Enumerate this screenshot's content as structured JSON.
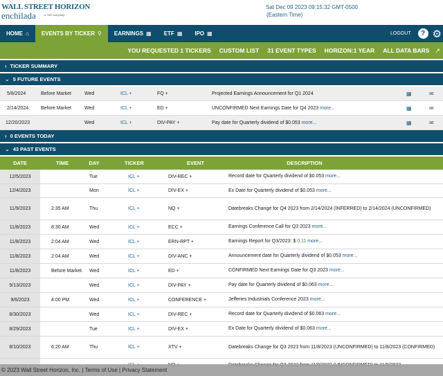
{
  "logo": {
    "line1": "WALL STREET HORIZON",
    "line2": "enchilada",
    "sub": "a TMX company"
  },
  "datetime": {
    "line1": "Sat Dec 09 2023 09:15:32 GMT-0500",
    "line2": "(Eastern Time)"
  },
  "nav": {
    "items": [
      {
        "label": "HOME",
        "icon": "home-icon"
      },
      {
        "label": "EVENTS BY TICKER",
        "icon": "search-icon"
      },
      {
        "label": "EARNINGS",
        "icon": "calendar-icon"
      },
      {
        "label": "ETF",
        "icon": "calendar-icon"
      },
      {
        "label": "IPO",
        "icon": "calendar-icon"
      }
    ],
    "logout": "LOGOUT"
  },
  "settings": {
    "requested": "YOU REQUESTED 1 TICKERS",
    "custom_list": "CUSTOM LIST",
    "event_types": "31 EVENT TYPES",
    "horizon": "HORIZON:1 YEAR",
    "data_bars": "ALL DATA BARS"
  },
  "sections": {
    "ticker_summary": "TICKER SUMMARY",
    "future_events": "5 FUTURE EVENTS",
    "events_today": "0 EVENTS TODAY",
    "past_events": "43 PAST EVENTS"
  },
  "future_events": [
    {
      "date": "5/8/2024",
      "time": "Before Market",
      "day": "Wed",
      "ticker": "ICL +",
      "event": "FQ +",
      "description": "Projected Earnings Announcement for Q1 2024",
      "more": ""
    },
    {
      "date": "2/14/2024",
      "time": "Before Market",
      "day": "Wed",
      "ticker": "ICL +",
      "event": "ED +",
      "description": "UNCONFIRMED Next Earnings Date for Q4 2023",
      "more": "more..."
    },
    {
      "date": "12/20/2023",
      "time": "",
      "day": "Wed",
      "ticker": "ICL +",
      "event": "DIV-PAY +",
      "description": "Pay date for Quarterly dividend of $0.053",
      "more": "more..."
    }
  ],
  "past_headers": {
    "date": "DATE",
    "time": "TIME",
    "day": "DAY",
    "ticker": "TICKER",
    "event": "EVENT",
    "description": "DESCRIPTION"
  },
  "past_events": [
    {
      "date": "12/5/2023",
      "time": "",
      "day": "Tue",
      "ticker": "ICL +",
      "event": "DIV-REC +",
      "description": "Record date for Quarterly dividend of $0.053",
      "more": "more..."
    },
    {
      "date": "12/4/2023",
      "time": "",
      "day": "Mon",
      "ticker": "ICL +",
      "event": "DIV-EX +",
      "description": "Ex Date for Quarterly dividend of $0.053",
      "more": "more..."
    },
    {
      "date": "11/9/2023",
      "time": "2:35 AM",
      "day": "Thu",
      "ticker": "ICL +",
      "event": "NQ +",
      "description": "Datebreaks Change for Q4 2023 from 2/14/2024 (INFERRED) to 2/14/2024 (UNCONFIRMED)",
      "more": ""
    },
    {
      "date": "11/8/2023",
      "time": "8:30 AM",
      "day": "Wed",
      "ticker": "ICL +",
      "event": "ECC +",
      "description": "Earnings Conference Call for Q3 2023",
      "more": "more..."
    },
    {
      "date": "11/8/2023",
      "time": "2:04 AM",
      "day": "Wed",
      "ticker": "ICL +",
      "event": "ERN-RPT +",
      "description": "Earnings Report for Q3/2023: $",
      "value": "0.11",
      "more": "more..."
    },
    {
      "date": "11/8/2023",
      "time": "2:04 AM",
      "day": "Wed",
      "ticker": "ICL +",
      "event": "DIV-ANC +",
      "description": "Announcement date for Quarterly dividend of $0.053",
      "more": "more..."
    },
    {
      "date": "11/8/2023",
      "time": "Before Market",
      "day": "Wed",
      "ticker": "ICL +",
      "event": "ED +",
      "description": "CONFIRMED Next Earnings Date for Q3 2023",
      "more": "more..."
    },
    {
      "date": "9/13/2023",
      "time": "",
      "day": "Wed",
      "ticker": "ICL +",
      "event": "DIV-PAY +",
      "description": "Pay date for Quarterly dividend of $0.063",
      "more": "more..."
    },
    {
      "date": "9/6/2023",
      "time": "4:00 PM",
      "day": "Wed",
      "ticker": "ICL +",
      "event": "CONFERENCE +",
      "description": "Jefferies Industrials Conference 2023",
      "more": "more..."
    },
    {
      "date": "8/30/2023",
      "time": "",
      "day": "Wed",
      "ticker": "ICL +",
      "event": "DIV-REC +",
      "description": "Record date for Quarterly dividend of $0.063",
      "more": "more..."
    },
    {
      "date": "8/29/2023",
      "time": "",
      "day": "Tue",
      "ticker": "ICL +",
      "event": "DIV-EX +",
      "description": "Ex Date for Quarterly dividend of $0.063",
      "more": "more..."
    },
    {
      "date": "8/10/2023",
      "time": "6:20 AM",
      "day": "Thu",
      "ticker": "ICL +",
      "event": "XTV +",
      "description": "Datebreaks Change for Q3 2023 from 11/8/2023 (UNCONFIRMED) to 11/8/2023 (CONFIRMED)",
      "more": ""
    },
    {
      "date": "",
      "time": "",
      "day": "",
      "ticker": "ICL +",
      "event": "NQ +",
      "description": "Datebreaks Change for Q3 2023 from 11/8/2023 (UNCONFIRMED) to 11/8/2023",
      "more": ""
    }
  ],
  "footer": {
    "copyright": "© 2023 Wall Street Horizon, Inc.",
    "terms": "Terms of Use",
    "privacy": "Privacy Statement",
    "separator": "|"
  }
}
